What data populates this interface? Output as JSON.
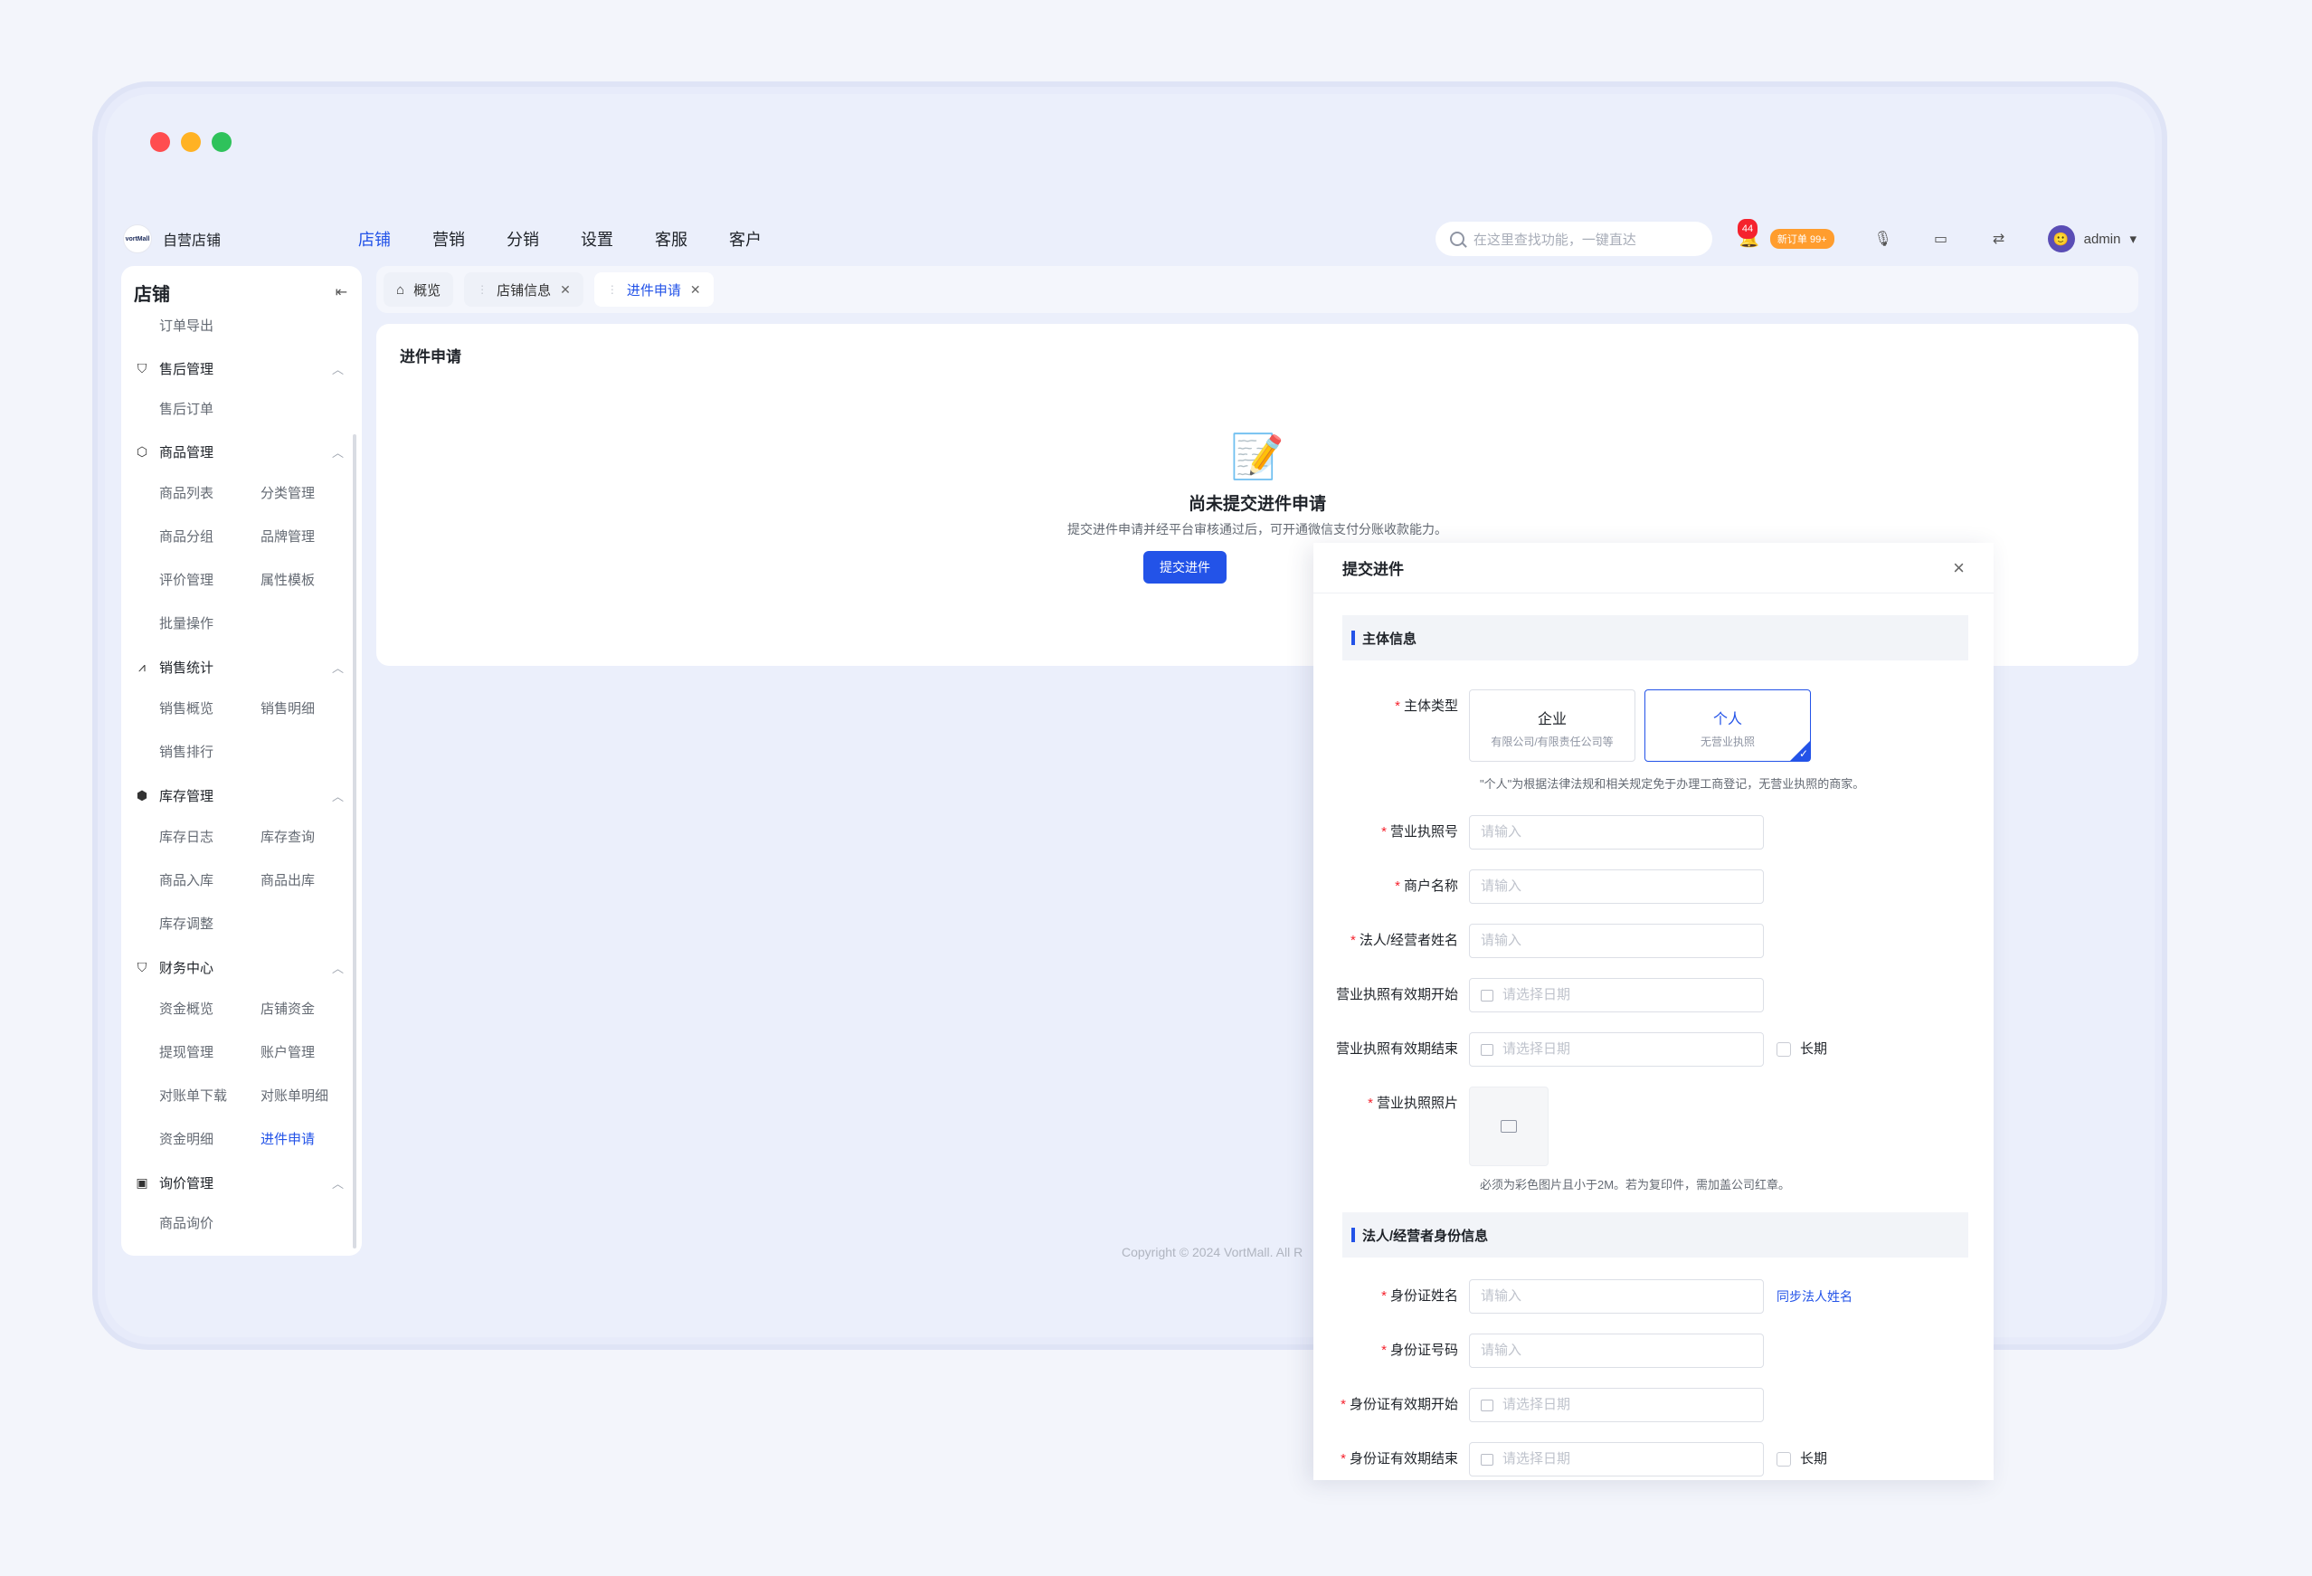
{
  "brand": {
    "logo_text": "vortMall",
    "name": "自营店铺"
  },
  "nav": {
    "items": [
      "店铺",
      "营销",
      "分销",
      "设置",
      "客服",
      "客户"
    ],
    "active": 0
  },
  "search": {
    "placeholder": "在这里查找功能，一键直达"
  },
  "notifications": {
    "count": "44",
    "new_orders": "新订单 99+"
  },
  "user": {
    "name": "admin",
    "avatar_char": "🙂"
  },
  "sidebar": {
    "title": "店铺",
    "top_item": "订单导出",
    "groups": [
      {
        "label": "售后管理",
        "icon": "shield-icon",
        "items": [
          "售后订单"
        ]
      },
      {
        "label": "商品管理",
        "icon": "cube-icon",
        "items": [
          "商品列表",
          "分类管理",
          "商品分组",
          "品牌管理",
          "评价管理",
          "属性模板",
          "批量操作"
        ]
      },
      {
        "label": "销售统计",
        "icon": "chart-icon",
        "items": [
          "销售概览",
          "销售明细",
          "销售排行"
        ]
      },
      {
        "label": "库存管理",
        "icon": "box-icon",
        "items": [
          "库存日志",
          "库存查询",
          "商品入库",
          "商品出库",
          "库存调整"
        ]
      },
      {
        "label": "财务中心",
        "icon": "wallet-icon",
        "items": [
          "资金概览",
          "店铺资金",
          "提现管理",
          "账户管理",
          "对账单下载",
          "对账单明细",
          "资金明细",
          "进件申请"
        ]
      },
      {
        "label": "询价管理",
        "icon": "inquiry-icon",
        "items": [
          "商品询价"
        ]
      }
    ],
    "active_item": "进件申请"
  },
  "tabs": [
    {
      "label": "概览",
      "closable": false
    },
    {
      "label": "店铺信息",
      "closable": true
    },
    {
      "label": "进件申请",
      "closable": true,
      "active": true
    }
  ],
  "content": {
    "title": "进件申请",
    "empty_title": "尚未提交进件申请",
    "empty_desc": "提交进件申请并经平台审核通过后，可开通微信支付分账收款能力。",
    "submit_button": "提交进件",
    "copyright": "Copyright © 2024 VortMall. All R"
  },
  "drawer": {
    "title": "提交进件",
    "section_main": "主体信息",
    "subject_type_label": "主体类型",
    "card_enterprise": {
      "title": "企业",
      "sub": "有限公司/有限责任公司等"
    },
    "card_personal": {
      "title": "个人",
      "sub": "无营业执照"
    },
    "personal_hint": "\"个人\"为根据法律法规和相关规定免于办理工商登记，无营业执照的商家。",
    "fields": {
      "license_no": {
        "label": "营业执照号",
        "placeholder": "请输入"
      },
      "merchant_name": {
        "label": "商户名称",
        "placeholder": "请输入"
      },
      "legal_name": {
        "label": "法人/经营者姓名",
        "placeholder": "请输入"
      },
      "license_start": {
        "label": "营业执照有效期开始",
        "placeholder": "请选择日期"
      },
      "license_end": {
        "label": "营业执照有效期结束",
        "placeholder": "请选择日期"
      },
      "license_photo": {
        "label": "营业执照照片"
      }
    },
    "long_term": "长期",
    "photo_hint": "必须为彩色图片且小于2M。若为复印件，需加盖公司红章。",
    "section_id": "法人/经营者身份信息",
    "id_fields": {
      "id_name": {
        "label": "身份证姓名",
        "placeholder": "请输入"
      },
      "id_no": {
        "label": "身份证号码",
        "placeholder": "请输入"
      },
      "id_start": {
        "label": "身份证有效期开始",
        "placeholder": "请选择日期"
      },
      "id_end": {
        "label": "身份证有效期结束",
        "placeholder": "请选择日期"
      }
    },
    "sync_link": "同步法人姓名"
  }
}
